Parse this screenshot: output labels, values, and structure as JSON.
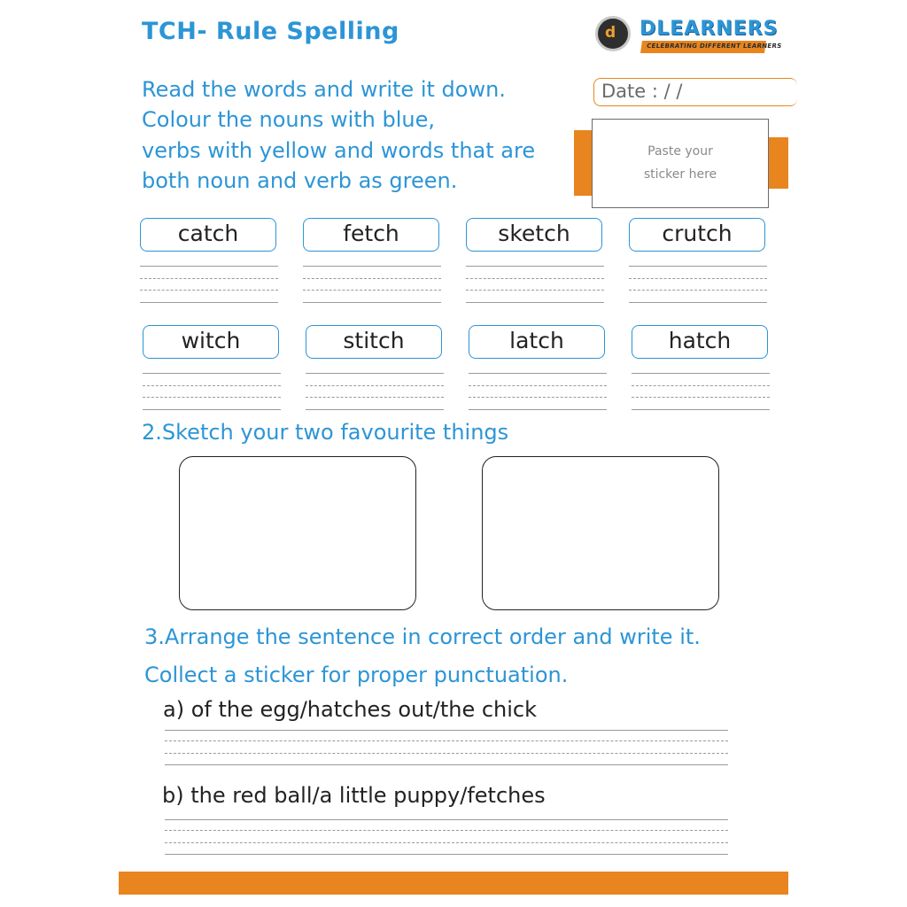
{
  "header": {
    "title": "TCH- Rule Spelling",
    "logo_text": "DLEARNERS",
    "logo_tagline": "CELEBRATING DIFFERENT LEARNERS",
    "logo_mark": "d"
  },
  "instructions": [
    "Read the words and write it down.",
    "Colour the nouns with blue,",
    "verbs with yellow and words that are",
    "both noun and verb as green."
  ],
  "date_label": "Date :    /    /",
  "sticker": {
    "line1": "Paste your",
    "line2": "sticker here"
  },
  "words_row1": [
    "catch",
    "fetch",
    "sketch",
    "crutch"
  ],
  "words_row2": [
    "witch",
    "stitch",
    "latch",
    "hatch"
  ],
  "section2": {
    "title": "2.Sketch your two favourite things"
  },
  "section3": {
    "title": "3.Arrange the sentence in correct order and write it.",
    "subtitle": "Collect a sticker for proper punctuation.",
    "questions": [
      "a)  of the egg/hatches out/the chick",
      "b) the red ball/a little puppy/fetches"
    ]
  },
  "colors": {
    "accent_blue": "#2c95d6",
    "accent_orange": "#e8851f"
  }
}
